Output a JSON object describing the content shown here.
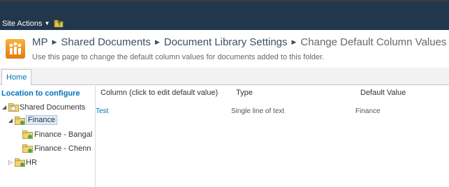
{
  "topbar": {
    "site_actions_label": "Site Actions"
  },
  "breadcrumb": {
    "site": "MP",
    "library": "Shared Documents",
    "settings": "Document Library Settings",
    "current": "Change Default Column Values"
  },
  "page_description": "Use this page to change the default column values for documents added to this folder.",
  "ribbon": {
    "tabs": [
      {
        "label": "Home"
      }
    ]
  },
  "left_nav": {
    "heading": "Location to configure",
    "tree": [
      {
        "label": "Shared Documents",
        "level": 0,
        "expanded": true
      },
      {
        "label": "Finance",
        "level": 1,
        "expanded": true,
        "selected": true
      },
      {
        "label": "Finance - Bangal",
        "level": 2
      },
      {
        "label": "Finance - Chenn",
        "level": 2
      },
      {
        "label": "HR",
        "level": 1,
        "expanded": false
      }
    ]
  },
  "table": {
    "headers": [
      "Column (click to edit default value)",
      "Type",
      "Default Value"
    ],
    "rows": [
      {
        "column": "Test",
        "type": "Single line of text",
        "default_value": "Finance"
      }
    ]
  },
  "colors": {
    "topbar": "#21374c",
    "link": "#0072bc",
    "logo": "#f29318"
  }
}
